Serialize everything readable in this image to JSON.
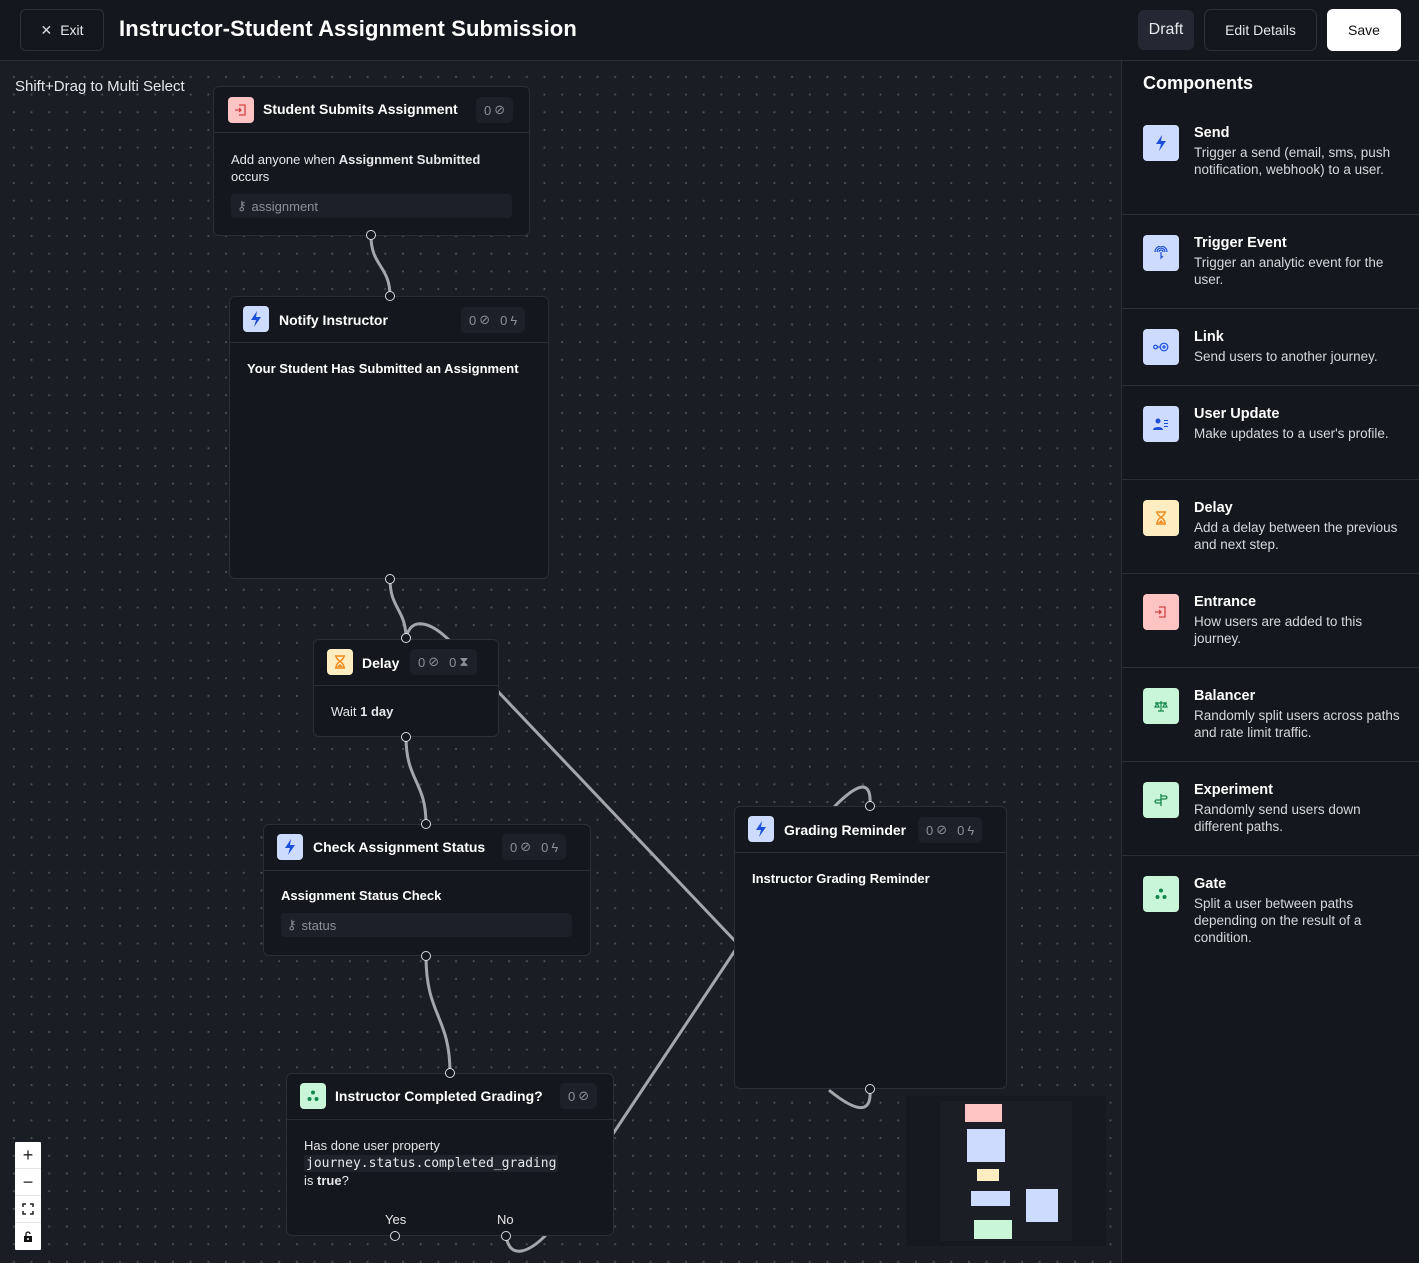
{
  "header": {
    "exit_label": "Exit",
    "title": "Instructor-Student Assignment Submission",
    "status_badge": "Draft",
    "edit_details_label": "Edit Details",
    "save_label": "Save"
  },
  "canvas": {
    "hint": "Shift+Drag to Multi Select",
    "nodes": {
      "entrance": {
        "title": "Student Submits Assignment",
        "type": "entrance",
        "completed_count": "0",
        "body_prefix": "Add anyone when ",
        "body_event": "Assignment Submitted",
        "body_suffix": " occurs",
        "key_field": "assignment"
      },
      "notify": {
        "title": "Notify Instructor",
        "type": "send",
        "completed_count": "0",
        "sent_count": "0",
        "template_name": "Your Student Has Submitted an Assignment"
      },
      "delay": {
        "title": "Delay",
        "type": "delay",
        "completed_count": "0",
        "waiting_count": "0",
        "body_prefix": "Wait ",
        "duration": "1 day"
      },
      "check": {
        "title": "Check Assignment Status",
        "type": "send",
        "completed_count": "0",
        "sent_count": "0",
        "template_name": "Assignment Status Check",
        "key_field": "status"
      },
      "gate": {
        "title": "Instructor Completed Grading?",
        "type": "gate",
        "completed_count": "0",
        "body_prefix": "Has done user property",
        "property": "journey.status.completed_grading",
        "body_is": "is ",
        "value": "true",
        "body_suffix": "?",
        "yes_label": "Yes",
        "no_label": "No"
      },
      "reminder": {
        "title": "Grading Reminder",
        "type": "send",
        "completed_count": "0",
        "sent_count": "0",
        "template_name": "Instructor Grading Reminder"
      }
    },
    "zoom_controls": {
      "zoom_in": "+",
      "zoom_out": "−",
      "fit_view": "fit",
      "lock": "lock"
    }
  },
  "sidebar": {
    "title": "Components",
    "components": [
      {
        "name": "Send",
        "description": "Trigger a send (email, sms, push notification, webhook) to a user.",
        "icon": "lightning-icon",
        "color": "#cddbff"
      },
      {
        "name": "Trigger Event",
        "description": "Trigger an analytic event for the user.",
        "icon": "tap-icon",
        "color": "#cddbff"
      },
      {
        "name": "Link",
        "description": "Send users to another journey.",
        "icon": "link-icon",
        "color": "#cddbff"
      },
      {
        "name": "User Update",
        "description": "Make updates to a user's profile.",
        "icon": "user-list-icon",
        "color": "#cddbff"
      },
      {
        "name": "Delay",
        "description": "Add a delay between the previous and next step.",
        "icon": "hourglass-icon",
        "color": "#fdedc0"
      },
      {
        "name": "Entrance",
        "description": "How users are added to this journey.",
        "icon": "enter-icon",
        "color": "#fec4c4"
      },
      {
        "name": "Balancer",
        "description": "Randomly split users across paths and rate limit traffic.",
        "icon": "scale-icon",
        "color": "#c9f5d9"
      },
      {
        "name": "Experiment",
        "description": "Randomly send users down different paths.",
        "icon": "signpost-icon",
        "color": "#c9f5d9"
      },
      {
        "name": "Gate",
        "description": "Split a user between paths depending on the result of a condition.",
        "icon": "gate-icon",
        "color": "#c9f5d9"
      }
    ]
  },
  "colors": {
    "send": "#cddbff",
    "entrance": "#fec4c4",
    "delay": "#fdedc0",
    "gate": "#c9f5d9",
    "send_icon": "#1d4ed8",
    "entrance_icon": "#d14343",
    "delay_icon": "#f08a1d",
    "gate_icon": "#14884a"
  }
}
